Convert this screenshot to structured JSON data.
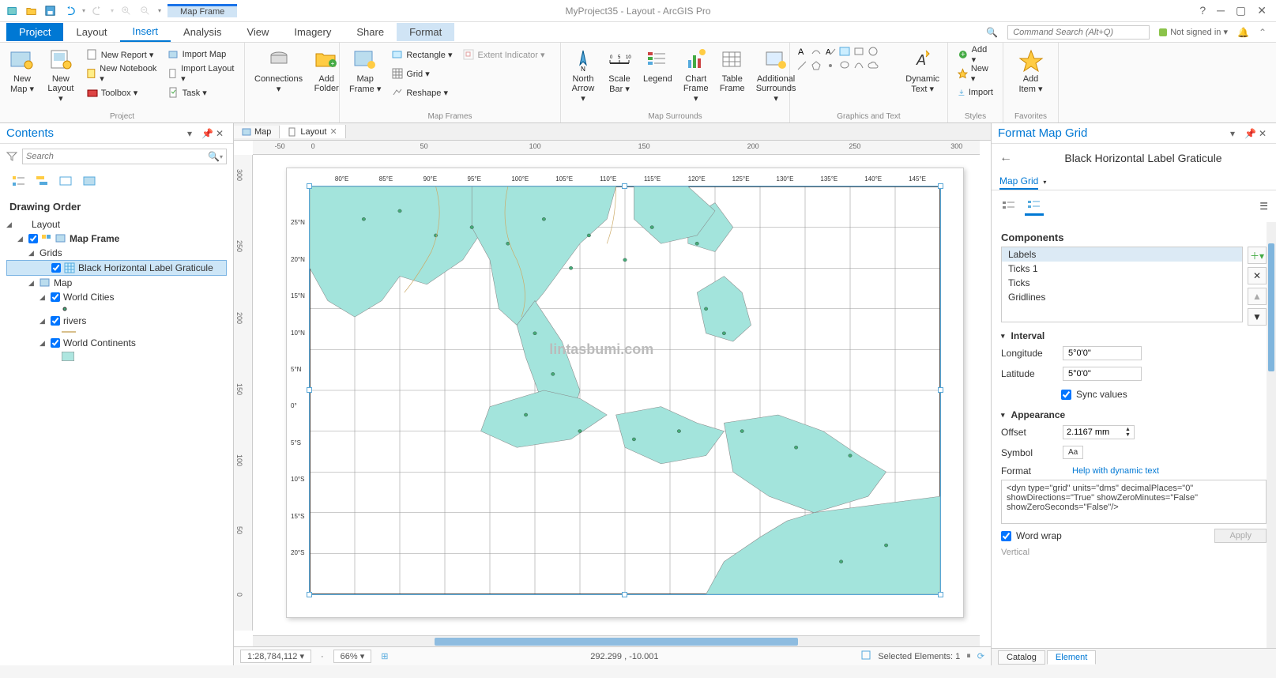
{
  "titlebar": {
    "context_group": "Map Frame",
    "app_title": "MyProject35 - Layout - ArcGIS Pro",
    "signin": "Not signed in ▾"
  },
  "ribbon_tabs": [
    "Project",
    "Layout",
    "Insert",
    "Analysis",
    "View",
    "Imagery",
    "Share",
    "Format"
  ],
  "ribbon_active": "Insert",
  "cmd_search_placeholder": "Command Search (Alt+Q)",
  "ribbon": {
    "group_project": {
      "label": "Project",
      "new_map": "New\nMap ▾",
      "new_layout": "New\nLayout ▾",
      "new_report": "New Report ▾",
      "new_notebook": "New Notebook ▾",
      "toolbox": "Toolbox ▾",
      "import_map": "Import Map",
      "import_layout": "Import Layout ▾",
      "task": "Task ▾",
      "connections": "Connections\n▾",
      "add_folder": "Add\nFolder"
    },
    "group_mapframes": {
      "label": "Map Frames",
      "map_frame": "Map\nFrame ▾",
      "rectangle": "Rectangle ▾",
      "grid": "Grid ▾",
      "reshape": "Reshape ▾",
      "extent_indicator": "Extent Indicator ▾"
    },
    "group_surrounds": {
      "label": "Map Surrounds",
      "north_arrow": "North\nArrow ▾",
      "scale_bar": "Scale\nBar ▾",
      "legend": "Legend",
      "chart_frame": "Chart\nFrame ▾",
      "table_frame": "Table\nFrame",
      "additional": "Additional\nSurrounds ▾"
    },
    "group_graphics": {
      "label": "Graphics and Text",
      "dynamic_text": "Dynamic\nText ▾"
    },
    "group_styles": {
      "label": "Styles",
      "add": "Add ▾",
      "new": "New ▾",
      "import": "Import"
    },
    "group_fav": {
      "label": "Favorites",
      "add_item": "Add\nItem ▾"
    }
  },
  "contents": {
    "title": "Contents",
    "search_placeholder": "Search",
    "section": "Drawing Order",
    "layout": "Layout",
    "map_frame": "Map Frame",
    "grids": "Grids",
    "graticule": "Black Horizontal Label Graticule",
    "map": "Map",
    "world_cities": "World Cities",
    "rivers": "rivers",
    "world_continents": "World Continents"
  },
  "doc_tabs": {
    "map": "Map",
    "layout": "Layout"
  },
  "ruler_h": [
    "-50",
    "0",
    "50",
    "100",
    "150",
    "200",
    "250",
    "300"
  ],
  "ruler_v": [
    "300",
    "250",
    "200",
    "150",
    "100",
    "50",
    "0"
  ],
  "map_labels": {
    "lon": [
      "80°E",
      "85°E",
      "90°E",
      "95°E",
      "100°E",
      "105°E",
      "110°E",
      "115°E",
      "120°E",
      "125°E",
      "130°E",
      "135°E",
      "140°E",
      "145°E"
    ],
    "lat": [
      "25°N",
      "20°N",
      "15°N",
      "10°N",
      "5°N",
      "0°",
      "5°S",
      "10°S",
      "15°S",
      "20°S"
    ],
    "watermark": "lintasbumi.com"
  },
  "status": {
    "scale": "1:28,784,112",
    "zoom": "66%",
    "coords": "292.299 , -10.001",
    "selected": "Selected Elements: 1"
  },
  "format_panel": {
    "title": "Format Map Grid",
    "subtitle": "Black Horizontal Label Graticule",
    "tab": "Map Grid",
    "components_title": "Components",
    "components": [
      "Labels",
      "Ticks 1",
      "Ticks",
      "Gridlines"
    ],
    "interval_title": "Interval",
    "longitude_label": "Longitude",
    "longitude_value": "5°0'0\"",
    "latitude_label": "Latitude",
    "latitude_value": "5°0'0\"",
    "sync_label": "Sync values",
    "appearance_title": "Appearance",
    "offset_label": "Offset",
    "offset_value": "2.1167 mm",
    "symbol_label": "Symbol",
    "symbol_preview": "Aa",
    "format_label": "Format",
    "format_help": "Help with dynamic text",
    "format_value": "<dyn type=\"grid\" units=\"dms\" decimalPlaces=\"0\" showDirections=\"True\" showZeroMinutes=\"False\" showZeroSeconds=\"False\"/>",
    "word_wrap": "Word wrap",
    "vertical": "Vertical",
    "apply": "Apply"
  },
  "bottom_tabs": {
    "catalog": "Catalog",
    "element": "Element"
  }
}
